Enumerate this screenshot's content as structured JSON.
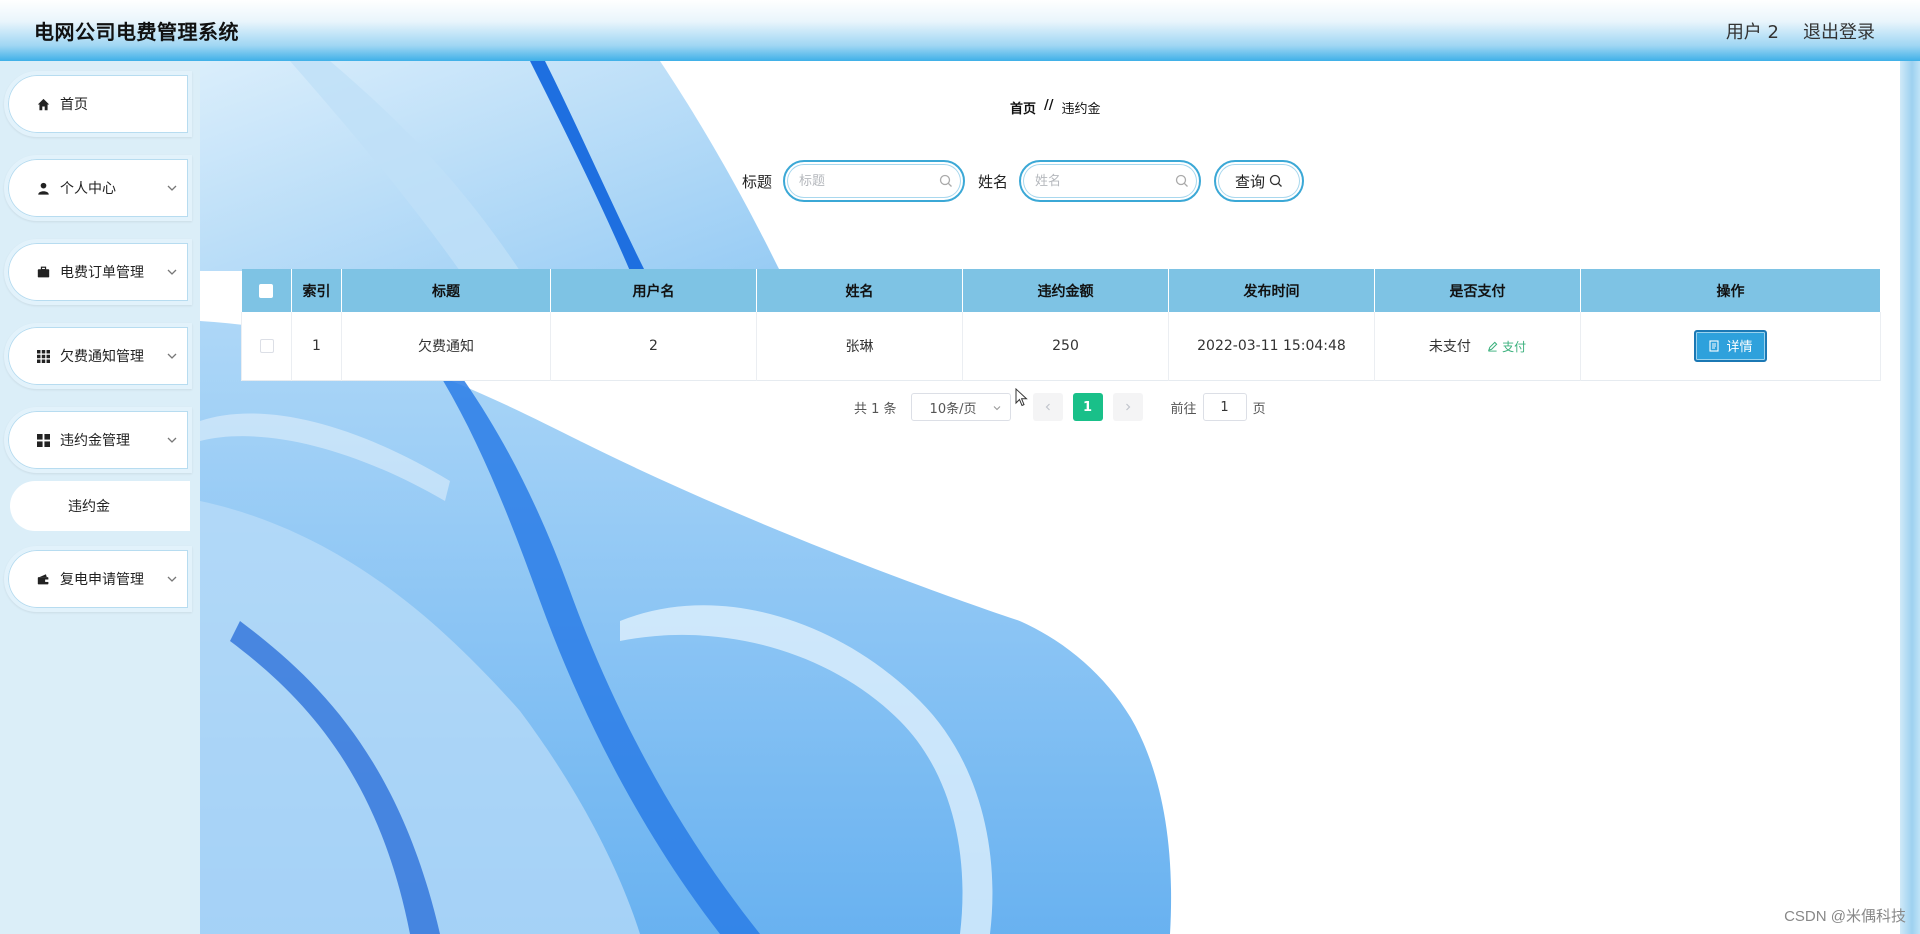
{
  "header": {
    "app_title": "电网公司电费管理系统",
    "user_label": "用户 2",
    "logout_label": "退出登录"
  },
  "sidebar": {
    "items": [
      {
        "label": "首页",
        "icon": "home-icon"
      },
      {
        "label": "个人中心",
        "icon": "user-icon"
      },
      {
        "label": "电费订单管理",
        "icon": "briefcase-icon"
      },
      {
        "label": "欠费通知管理",
        "icon": "grid-icon"
      },
      {
        "label": "违约金管理",
        "icon": "apps-icon"
      },
      {
        "label": "复电申请管理",
        "icon": "wallet-icon"
      }
    ],
    "active_submenu": "违约金"
  },
  "breadcrumb": {
    "home": "首页",
    "separator": "//",
    "current": "违约金"
  },
  "search": {
    "title_label": "标题",
    "title_placeholder": "标题",
    "name_label": "姓名",
    "name_placeholder": "姓名",
    "query_label": "查询"
  },
  "table": {
    "columns": [
      "索引",
      "标题",
      "用户名",
      "姓名",
      "违约金额",
      "发布时间",
      "是否支付",
      "操作"
    ],
    "rows": [
      {
        "index": "1",
        "title": "欠费通知",
        "username": "2",
        "name": "张琳",
        "amount": "250",
        "published": "2022-03-11 15:04:48",
        "paid_status": "未支付",
        "pay_action": "支付",
        "detail_label": "详情"
      }
    ]
  },
  "pagination": {
    "total_text": "共 1 条",
    "page_size": "10条/页",
    "current_page": "1",
    "goto_label": "前往",
    "goto_value": "1",
    "page_suffix": "页"
  },
  "watermark": "CSDN @米偶科技",
  "colors": {
    "accent": "#2ea1dc",
    "header_row": "#7ec3e4",
    "pager_active": "#19c089",
    "pay_link": "#3ab07c",
    "sidebar_bg": "#dbeef8"
  }
}
